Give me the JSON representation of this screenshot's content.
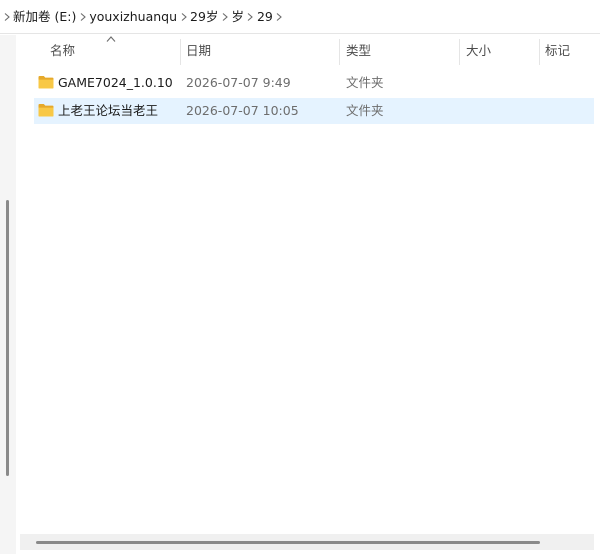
{
  "breadcrumb": {
    "items": [
      {
        "label": "新加卷 (E:)"
      },
      {
        "label": "youxizhuanqu"
      },
      {
        "label": "29岁"
      },
      {
        "label": "岁"
      },
      {
        "label": "29"
      }
    ]
  },
  "columns": {
    "name": "名称",
    "date": "日期",
    "type": "类型",
    "size": "大小",
    "tags": "标记"
  },
  "files": [
    {
      "name": "GAME7024_1.0.10",
      "date": "2026-07-07 9:49",
      "type": "文件夹",
      "size": "",
      "icon": "folder-icon",
      "selected": false
    },
    {
      "name": "上老王论坛当老王",
      "date": "2026-07-07 10:05",
      "type": "文件夹",
      "size": "",
      "icon": "folder-icon",
      "selected": true
    }
  ],
  "colors": {
    "selection": "#e5f3ff",
    "folder": "#f8c846",
    "folder_dark": "#e6a92a"
  }
}
